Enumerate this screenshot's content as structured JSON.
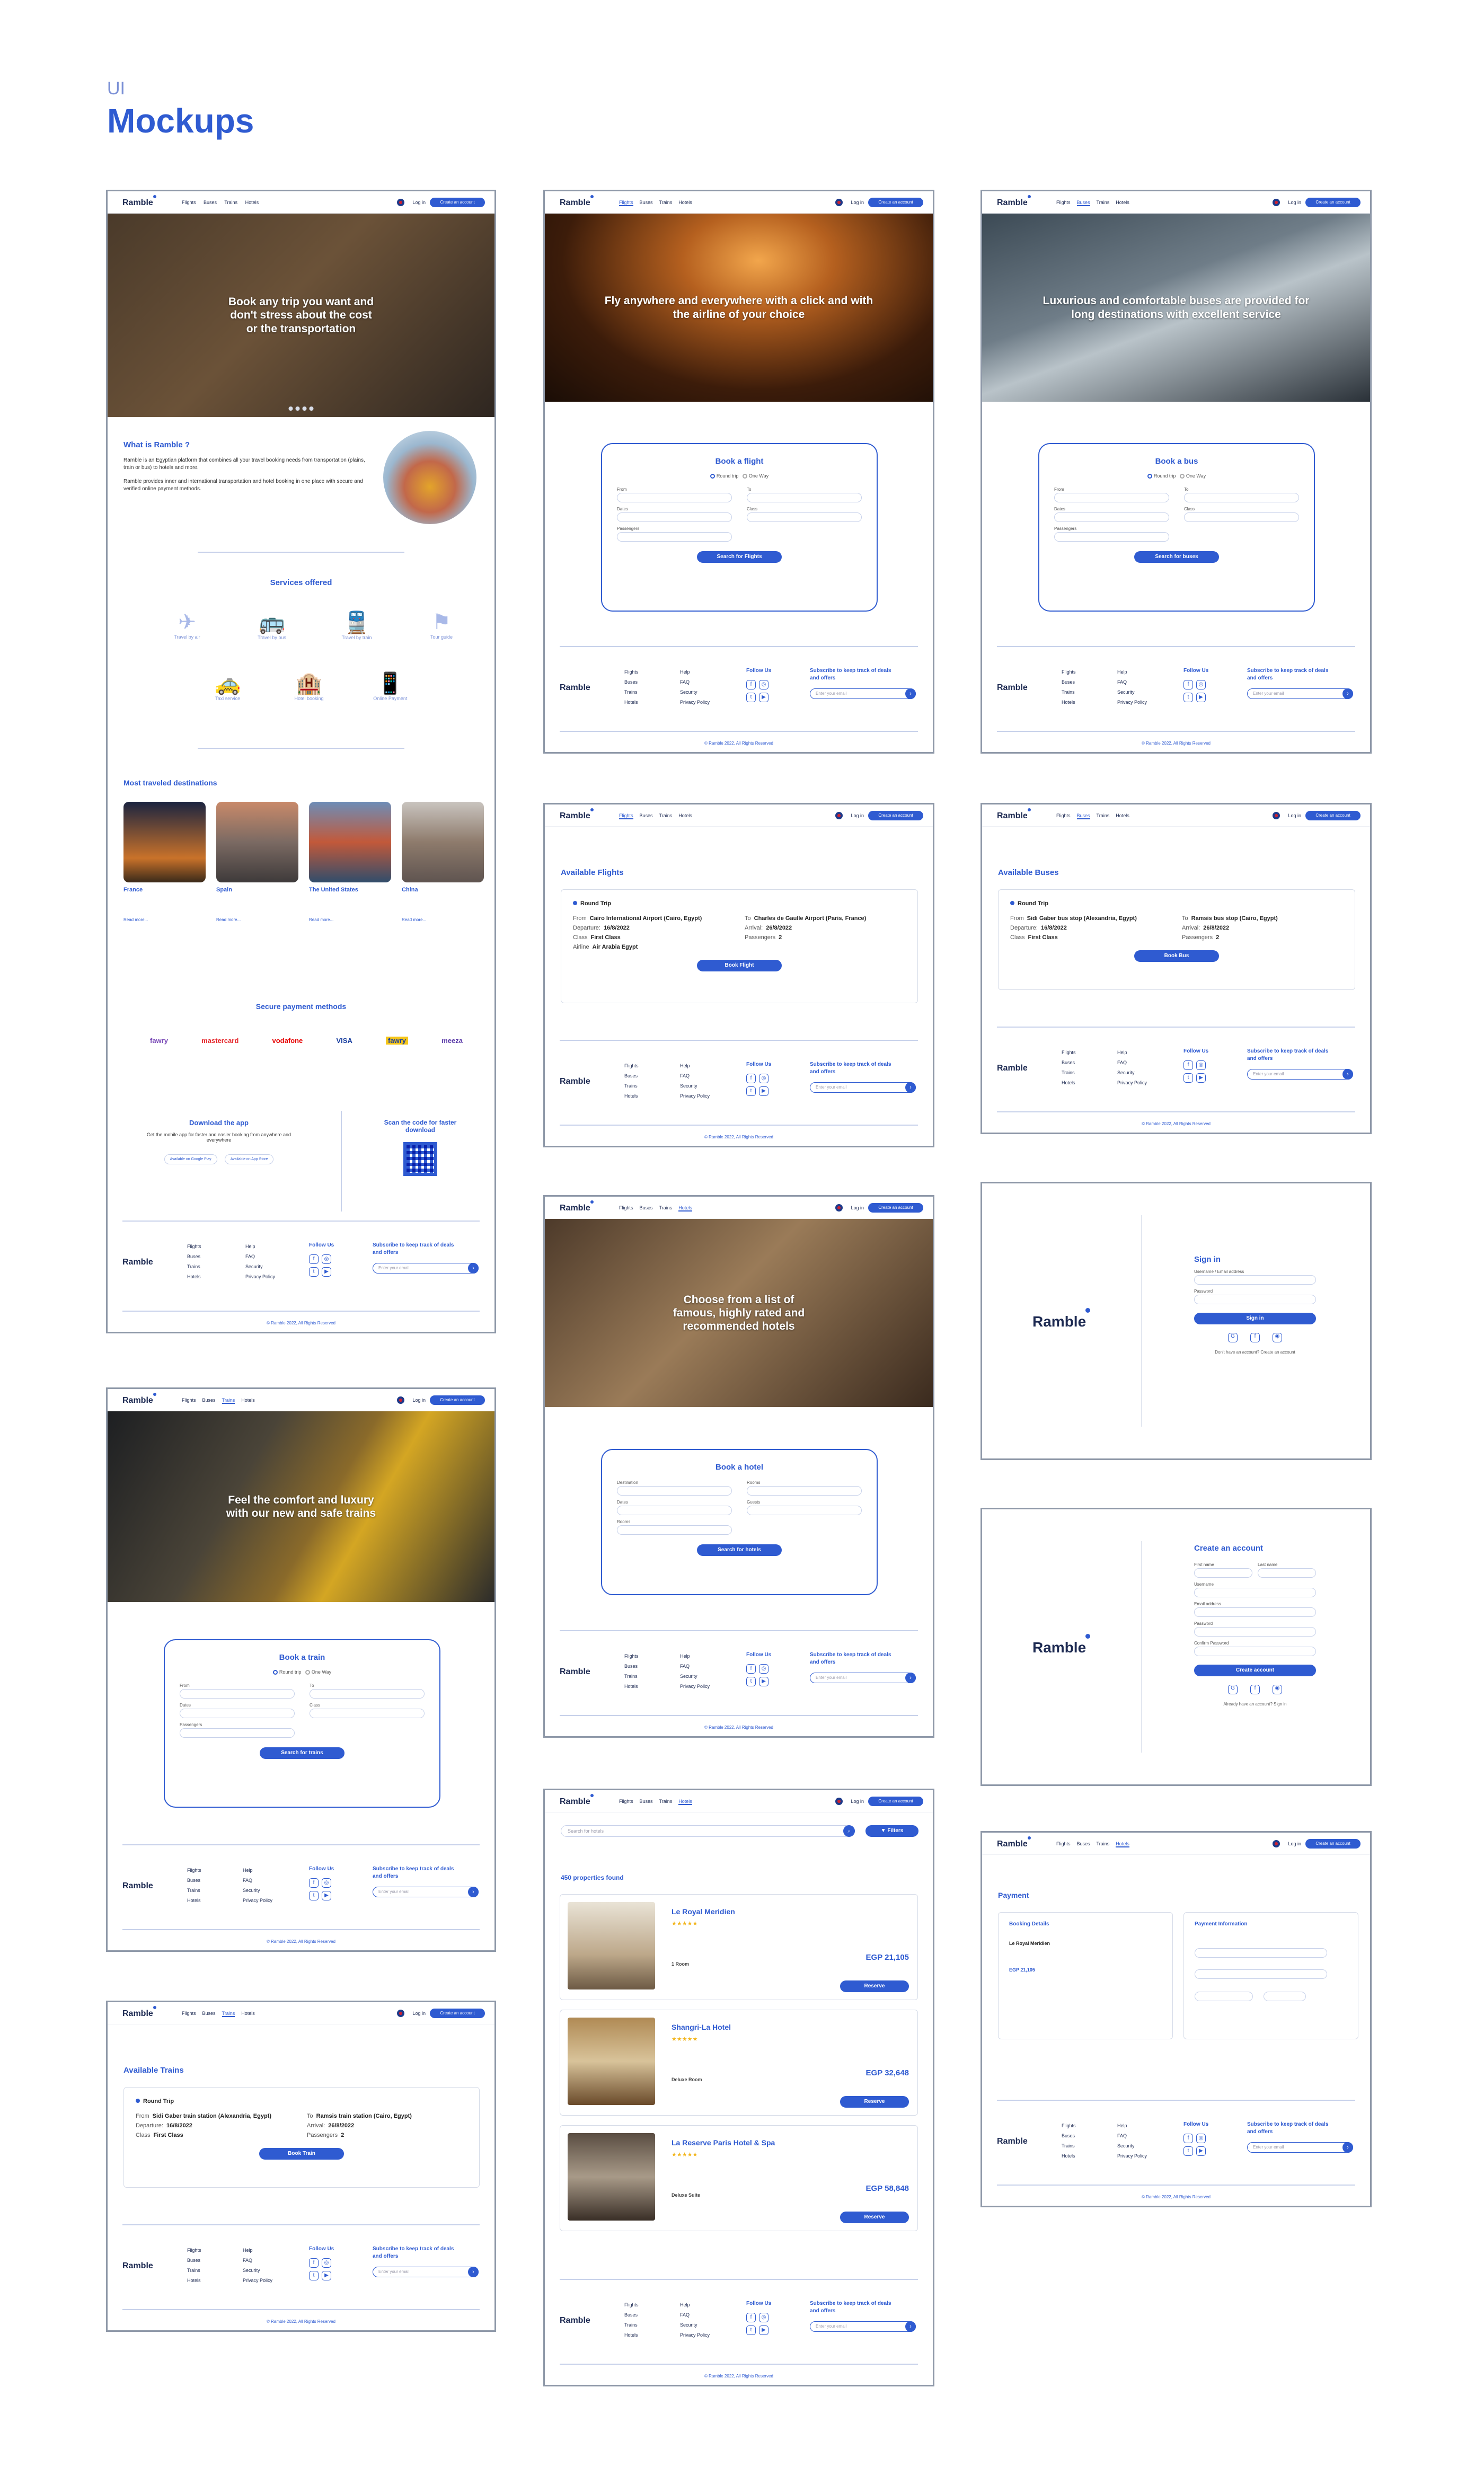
{
  "header": {
    "label": "UI",
    "title": "Mockups"
  },
  "common": {
    "logo": "Ramble",
    "nav": [
      "Flights",
      "Buses",
      "Trains",
      "Hotels"
    ],
    "login": "Log in",
    "create": "Create an account",
    "footer": {
      "col1": [
        "Flights",
        "Buses",
        "Trains",
        "Hotels"
      ],
      "col2": [
        "Help",
        "FAQ",
        "Security",
        "Privacy Policy"
      ],
      "follow": "Follow Us",
      "subscribe": "Subscribe to keep track of deals and offers",
      "email_placeholder": "Enter your email",
      "copyright": "© Ramble 2022, All Rights Reserved"
    },
    "labels": {
      "round": "Round trip",
      "oneway": "One Way",
      "from": "From",
      "to": "To",
      "dates": "Dates",
      "class": "Class",
      "passengers": "Passengers",
      "destination": "Destination",
      "checkin": "Check-in",
      "checkout": "Check-out",
      "rooms": "Rooms",
      "guests": "Guests"
    }
  },
  "home": {
    "hero": "Book any trip you want and don't stress about the cost or the transportation",
    "what": "What is Ramble ?",
    "about1": "Ramble is an Egyptian platform that combines all your travel booking needs from transportation (plains, train or bus) to hotels and more.",
    "about2": "Ramble provides inner and international transportation and hotel booking in one place with secure and verified online payment methods.",
    "services_title": "Services offered",
    "services": [
      "Travel by air",
      "Travel by bus",
      "Travel by train",
      "Tour guide",
      "Taxi service",
      "Hotel booking",
      "Online Payment"
    ],
    "dest_title": "Most traveled destinations",
    "destinations": [
      "France",
      "Spain",
      "The United States",
      "China"
    ],
    "read_more": "Read more...",
    "pay_title": "Secure payment methods",
    "payments": [
      "fawry",
      "mastercard",
      "vodafone",
      "VISA",
      "fawry",
      "meeza"
    ],
    "download_title": "Download the app",
    "download_text": "Get the mobile app for faster and easier booking from anywhere and everywhere",
    "google": "Available on Google Play",
    "apple": "Available on App Store",
    "scan": "Scan the code for faster download"
  },
  "flight": {
    "hero": "Fly anywhere and everywhere with a click and with the airline of your choice",
    "title": "Book a flight",
    "button": "Search for Flights"
  },
  "bus": {
    "hero": "Luxurious and comfortable buses are provided for long destinations with excellent service",
    "title": "Book a bus",
    "button": "Search for buses"
  },
  "train": {
    "hero": "Feel the comfort and luxury with our new and safe trains",
    "title": "Book a train",
    "button": "Search for trains"
  },
  "hotel": {
    "hero": "Choose from a list of famous, highly rated and recommended hotels",
    "title": "Book a hotel",
    "button": "Search for hotels"
  },
  "avail_flights": {
    "title": "Available Flights",
    "round": "Round Trip",
    "from": "Cairo International Airport (Cairo, Egypt)",
    "to": "Charles de Gaulle Airport (Paris, France)",
    "departure": "16/8/2022",
    "arrival": "26/8/2022",
    "class": "First Class",
    "passengers": "2",
    "airline": "Air Arabia Egypt",
    "button": "Book Flight"
  },
  "avail_buses": {
    "title": "Available Buses",
    "round": "Round Trip",
    "from": "Sidi Gaber bus stop (Alexandria, Egypt)",
    "to": "Ramsis bus stop (Cairo, Egypt)",
    "departure": "16/8/2022",
    "arrival": "26/8/2022",
    "class": "First Class",
    "passengers": "2",
    "button": "Book Bus"
  },
  "avail_trains": {
    "title": "Available Trains",
    "round": "Round Trip",
    "from": "Sidi Gaber train station (Alexandria, Egypt)",
    "to": "Ramsis train station (Cairo, Egypt)",
    "departure": "16/8/2022",
    "arrival": "26/8/2022",
    "class": "First Class",
    "passengers": "2",
    "button": "Book Train"
  },
  "signin": {
    "title": "Sign in",
    "user": "Username / Email address",
    "pass": "Password",
    "button": "Sign in",
    "footer": "Don't have an account? Create an account"
  },
  "signup": {
    "title": "Create an account",
    "first": "First name",
    "last": "Last name",
    "user": "Username",
    "email": "Email address",
    "pass": "Password",
    "confirm": "Confirm Password",
    "button": "Create account",
    "footer": "Already have an account? Sign in"
  },
  "properties": {
    "search": "Search for hotels",
    "filters": "Filters",
    "count": "450 properties found",
    "hotels": [
      {
        "name": "Le Royal Meridien",
        "room": "1 Room",
        "price": "EGP 21,105",
        "button": "Reserve"
      },
      {
        "name": "Shangri-La Hotel",
        "room": "Deluxe Room",
        "price": "EGP 32,648",
        "button": "Reserve"
      },
      {
        "name": "La Reserve Paris Hotel & Spa",
        "room": "Deluxe Suite",
        "price": "EGP 58,848",
        "button": "Reserve"
      }
    ]
  },
  "payment": {
    "title": "Payment",
    "booking": "Booking Details",
    "info": "Payment Information",
    "hotel": "Le Royal Meridien",
    "price": "EGP 21,105"
  }
}
